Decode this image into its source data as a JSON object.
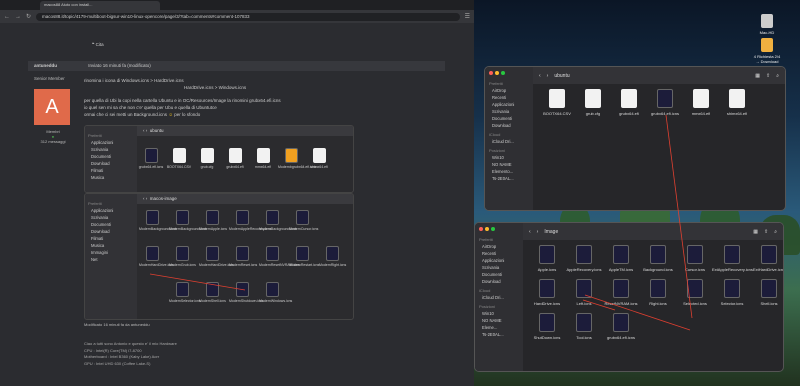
{
  "browser": {
    "tab_title": "macos88 Aiuto con install...",
    "url": "macos88.it/topic/4179-multiboot-bigsur-win10-linux-opencore/page/3/?tab=comments#comment-107833",
    "nav_icons": [
      "back-icon",
      "forward-icon",
      "reload-icon",
      "home-icon"
    ]
  },
  "forum": {
    "cita": "Cita",
    "author": "antuneddu",
    "post_date": "Inviato 16 minuti fa (modificato)",
    "role": "Senior Member",
    "avatar_letter": "A",
    "status": "Membri",
    "count": "312 messaggi",
    "line1": "rinomina  i icona di      Windows.icns  >  HardDrive.icns",
    "line2": "HardDrive.icns  >  Windows.icns",
    "line3": "per quella di Ubi la copi nella cartella Ubuntu e in OC/Resources/Image   la rinomini grubx64.efi.icns",
    "line4": "io quel sen mi sa che non c'e' quella per Ubu e quella di Ubuntutce",
    "line5": "ormai che ci sei metti un Background.icns",
    "line5b": "per lo sfondo",
    "modified": "Modificato 16 minuti fa da antuneddu",
    "sig1": "Ciao a tutti sono Antonio e questo e' il mio Hardware",
    "sig2": "CPU : Intel(R) Core(TM) i7-8700",
    "sig3": "Motherboard : Intel B360 (Kaby Lake) Aorr",
    "sig4": "GPU : Intel UHD 630 (Coffee Lake-S)"
  },
  "embedded": {
    "win1_title": "ubuntu",
    "win1_items": [
      "grubx64.efi.icns",
      "BOOTX64.CSV",
      "grub.cfg",
      "grubx64.efi",
      "mmx64.efi",
      "Modernbgrubx64.efi.icns",
      "shimx64.efi"
    ],
    "win2_title": "macos-image",
    "win2_sidebar_head": "Preferiti",
    "win2_sidebar": [
      "Applicazioni",
      "Scrivania",
      "Documenti",
      "Download",
      "Filmati",
      "Musica",
      "Immagini",
      "Net"
    ],
    "win2_items": [
      "ModernBackground.icns",
      "ModernBackground.icns",
      "ModernApple.icns",
      "ModernAppleRecovery.icns",
      "ModernBackground.icns",
      "ModernCursor.icns",
      "",
      "ModernHardDrive.icns",
      "ModernGrub.icns",
      "ModernHardDrive.icns",
      "ModernReset.icns",
      "ModernResetNVRAM.icns",
      "ModernRestart.icns",
      "ModernRight.icns",
      "",
      "ModernSelector.icns",
      "ModernShell.icns",
      "ModernShutdown.icns",
      "ModernWindows.icns"
    ],
    "win1_sidebar_head": "Preferiti",
    "win1_sidebar": [
      "Applicazioni",
      "Scrivania",
      "Documenti",
      "Download",
      "Filmati",
      "Musica"
    ]
  },
  "finder1": {
    "title": "ubuntu",
    "sidebar": [
      {
        "head": "Preferiti"
      },
      {
        "item": "AirDrop"
      },
      {
        "item": "Recenti"
      },
      {
        "item": "Applicazioni"
      },
      {
        "item": "Scrivania"
      },
      {
        "item": "Documenti"
      },
      {
        "item": "Download"
      },
      {
        "head": "iCloud"
      },
      {
        "item": "iCloud Dri..."
      },
      {
        "head": "Posizioni"
      },
      {
        "item": "Win10"
      },
      {
        "item": "NO NAME"
      },
      {
        "item": "Elemento..."
      },
      {
        "item": "Ts-2E0AL..."
      }
    ],
    "files": [
      "BOOTX64.CSV",
      "grub.cfg",
      "grubx64.efi",
      "grubx64.efi.icns",
      "mmx64.efi",
      "shimx64.efi"
    ]
  },
  "finder2": {
    "title": "Image",
    "sidebar": [
      {
        "head": "Preferiti"
      },
      {
        "item": "AirDrop"
      },
      {
        "item": "Recenti"
      },
      {
        "item": "Applicazioni"
      },
      {
        "item": "Scrivania"
      },
      {
        "item": "Documenti"
      },
      {
        "item": "Download"
      },
      {
        "head": "iCloud"
      },
      {
        "item": "iCloud Dri..."
      },
      {
        "head": "Posizioni"
      },
      {
        "item": "Win10"
      },
      {
        "item": "NO NAME"
      },
      {
        "item": "Eleme..."
      },
      {
        "item": "Ts-2E0AL..."
      }
    ],
    "files": [
      "Apple.icns",
      "AppleRecovery.icns",
      "AppleTM.icns",
      "Background.icns",
      "Cursor.icns",
      "ExtAppleRecovery.icns",
      "ExtHardDrive.icns",
      "HardDrive.icns",
      "Left.icns",
      "ResetNVRAM.icns",
      "Right.icns",
      "Selected.icns",
      "Selector.icns",
      "Shell.icns",
      "ShutDown.icns",
      "Tool.icns",
      "grubx64.efi.icns"
    ]
  },
  "desktop": {
    "icon1": "Mac-HD",
    "icon2": "4 Richiesta\n2/4 → Download"
  }
}
